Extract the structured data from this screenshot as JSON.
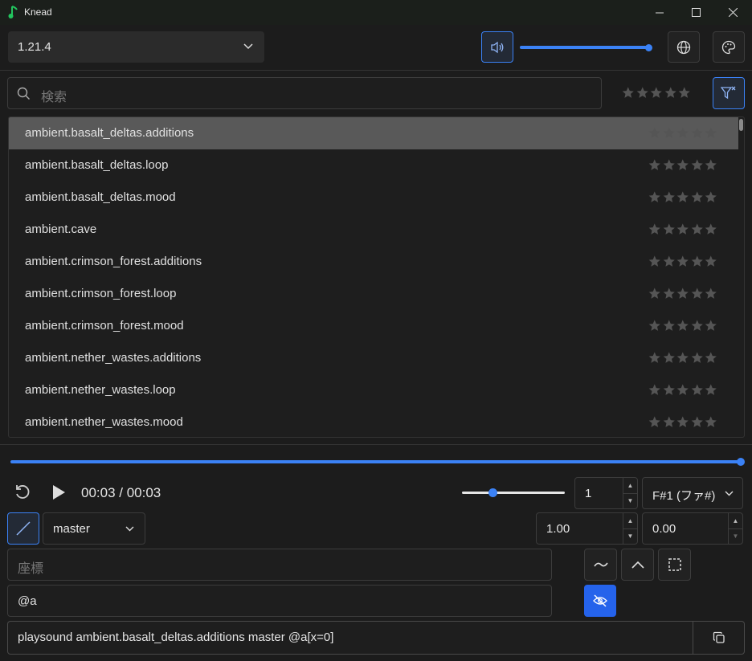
{
  "window": {
    "title": "Knead"
  },
  "toolbar": {
    "version": "1.21.4",
    "volume_percent": 100
  },
  "search": {
    "placeholder": "検索"
  },
  "sounds": [
    {
      "name": "ambient.basalt_deltas.additions",
      "selected": true
    },
    {
      "name": "ambient.basalt_deltas.loop"
    },
    {
      "name": "ambient.basalt_deltas.mood"
    },
    {
      "name": "ambient.cave"
    },
    {
      "name": "ambient.crimson_forest.additions"
    },
    {
      "name": "ambient.crimson_forest.loop"
    },
    {
      "name": "ambient.crimson_forest.mood"
    },
    {
      "name": "ambient.nether_wastes.additions"
    },
    {
      "name": "ambient.nether_wastes.loop"
    },
    {
      "name": "ambient.nether_wastes.mood"
    }
  ],
  "player": {
    "time": "00:03 / 00:03",
    "progress_percent": 100,
    "speed_fraction": 0.3
  },
  "controls": {
    "count": "1",
    "note": "F#1 (ファ#)",
    "source": "master",
    "volume": "1.00",
    "min_volume": "0.00",
    "coords_placeholder": "座標",
    "target": "@a"
  },
  "command": {
    "text": "playsound ambient.basalt_deltas.additions master @a[x=0]"
  },
  "colors": {
    "accent": "#3b82f6",
    "star": "#555555",
    "app_icon": "#22c55e"
  }
}
